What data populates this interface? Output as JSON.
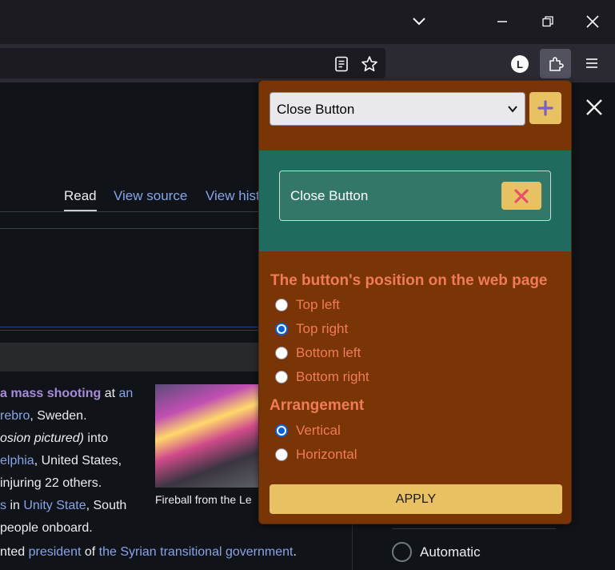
{
  "browser": {
    "icons": [
      "chevron-down-icon",
      "minimize-icon",
      "restore-icon",
      "close-icon",
      "reader-view-icon",
      "bookmark-star-icon",
      "account-avatar-icon",
      "extensions-icon",
      "menu-icon"
    ],
    "account_initial": "L"
  },
  "page": {
    "tabs": [
      {
        "label": "Read"
      },
      {
        "label": "View source"
      },
      {
        "label": "View hist"
      }
    ],
    "article_lines": [
      {
        "parts": [
          {
            "t": "a mass shooting",
            "k": "link-v"
          },
          {
            "t": " at ",
            "k": ""
          },
          {
            "t": "an",
            "k": "link"
          }
        ]
      },
      {
        "parts": [
          {
            "t": "rebro",
            "k": "link"
          },
          {
            "t": ", Sweden.",
            "k": ""
          }
        ]
      },
      {
        "parts": [
          {
            "t": "osion pictured)",
            "k": "italic"
          },
          {
            "t": " into",
            "k": ""
          }
        ]
      },
      {
        "parts": [
          {
            "t": "elphia",
            "k": "link"
          },
          {
            "t": ", United States,",
            "k": ""
          }
        ]
      },
      {
        "parts": [
          {
            "t": " injuring 22 others.",
            "k": ""
          }
        ]
      },
      {
        "parts": [
          {
            "t": "s",
            "k": "link"
          },
          {
            "t": " in ",
            "k": ""
          },
          {
            "t": "Unity State",
            "k": "link"
          },
          {
            "t": ", South",
            "k": ""
          }
        ]
      },
      {
        "parts": [
          {
            "t": "people onboard.",
            "k": ""
          }
        ]
      },
      {
        "parts": [
          {
            "t": "nted ",
            "k": ""
          },
          {
            "t": "president",
            "k": "link"
          },
          {
            "t": " of ",
            "k": ""
          },
          {
            "t": "the Syrian transitional government",
            "k": "link"
          },
          {
            "t": ".",
            "k": ""
          }
        ]
      }
    ],
    "thumbnail_caption": "Fireball from the Le",
    "side_option": "Automatic"
  },
  "popup": {
    "select": {
      "selected": "Close Button"
    },
    "add_button_symbol": "+",
    "preview": {
      "label": "Close Button",
      "close_symbol": "✕"
    },
    "position_heading": "The button's position on the web page",
    "positions": [
      {
        "label": "Top left",
        "checked": false
      },
      {
        "label": "Top right",
        "checked": true
      },
      {
        "label": "Bottom left",
        "checked": false
      },
      {
        "label": "Bottom right",
        "checked": false
      }
    ],
    "arrangement_heading": "Arrangement",
    "arrangements": [
      {
        "label": "Vertical",
        "checked": true
      },
      {
        "label": "Horizontal",
        "checked": false
      }
    ],
    "apply_label": "APPLY",
    "colors": {
      "background": "#7a3507",
      "accent_yellow": "#e8c163",
      "preview_teal": "#1f6b5e",
      "heading_orange": "#f07a5a",
      "radio_blue": "#0a60d8",
      "close_red": "#e8506a",
      "plus_purple": "#7a5fc4"
    }
  }
}
